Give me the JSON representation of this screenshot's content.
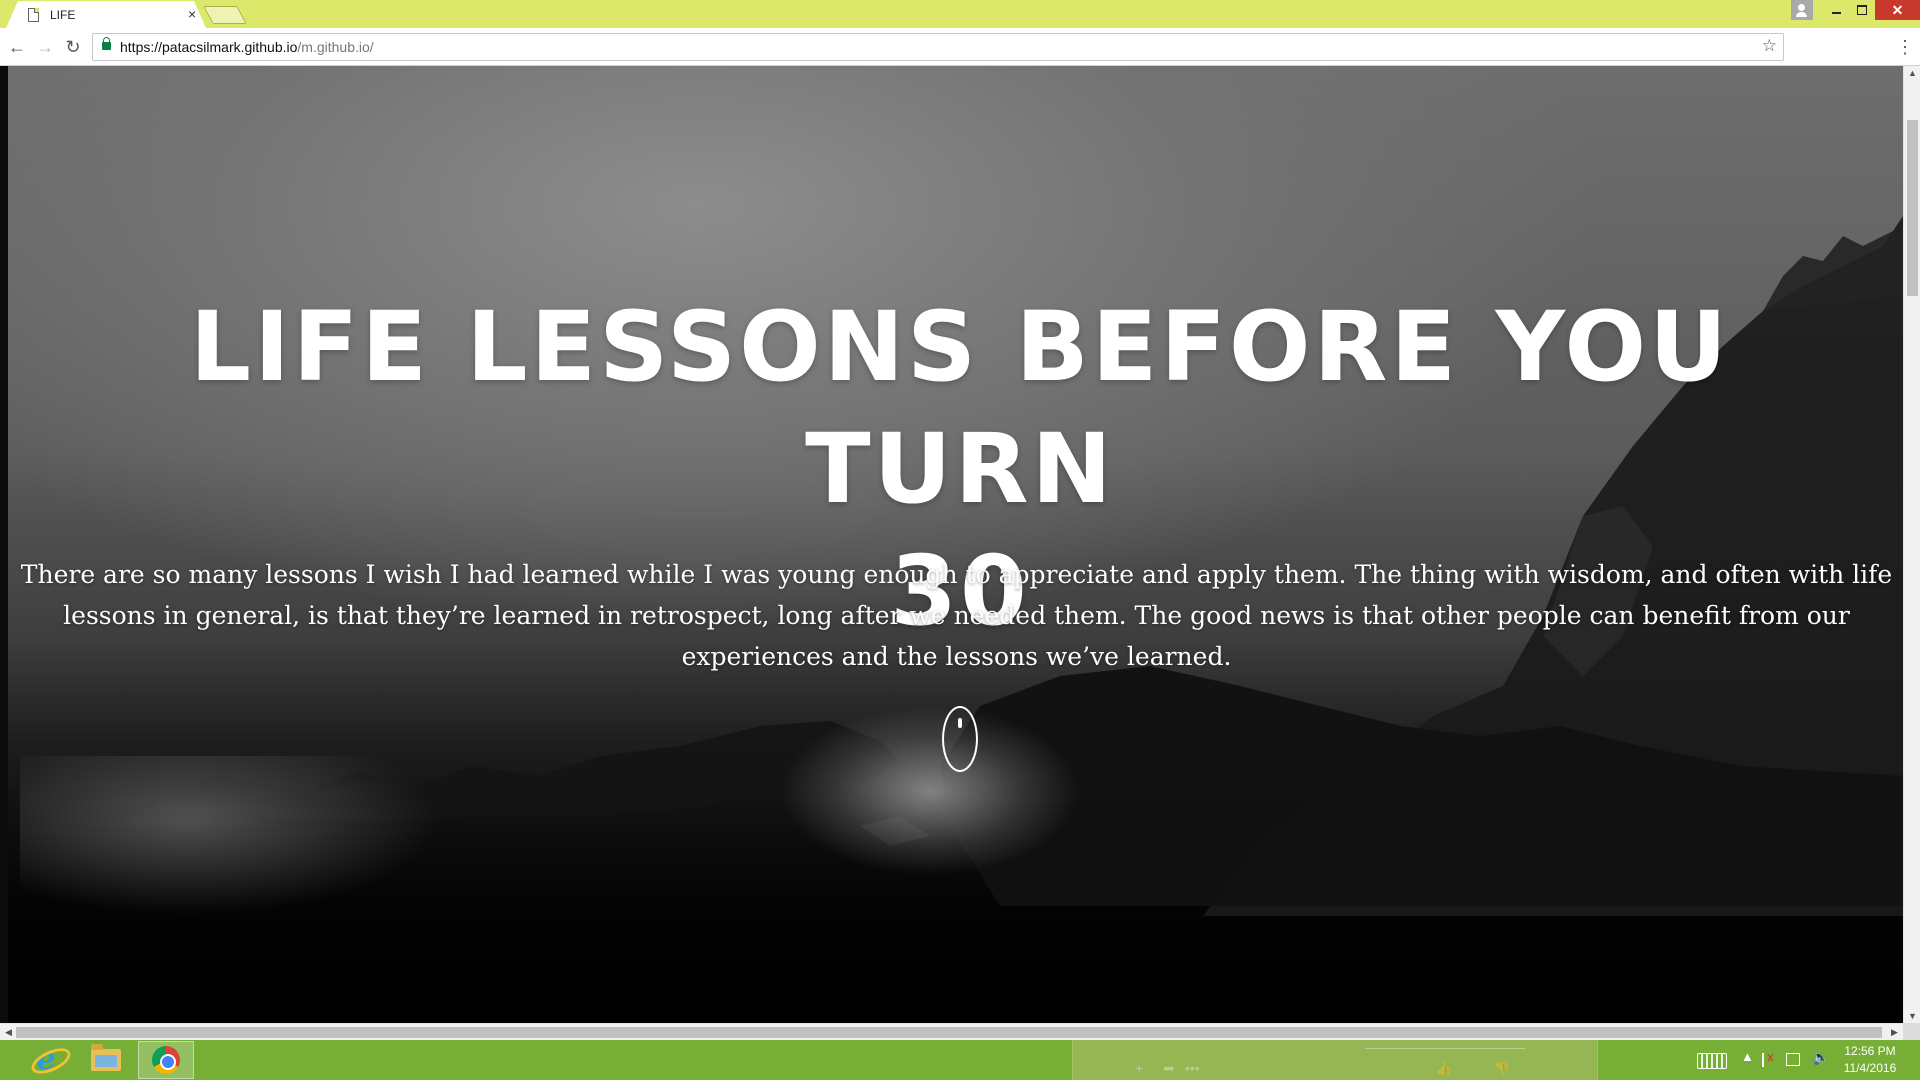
{
  "window": {
    "tab_title": "LIFE",
    "tab_close": "×",
    "minimize": "",
    "maximize": "",
    "close": "✕"
  },
  "toolbar": {
    "back": "←",
    "forward": "→",
    "reload": "↻",
    "url_host": "https://patacsilmark.github.io",
    "url_path": "/m.github.io/",
    "bookmark_star": "☆",
    "menu": "⋮"
  },
  "page": {
    "headline_line1": "LIFE LESSONS BEFORE YOU TURN",
    "headline_line2": "30",
    "intro": "There are so many lessons I wish I had learned while I was young enough to appreciate and apply them. The thing with wisdom, and often with life lessons in general, is that they’re learned in retrospect, long after we needed them. The good news is that other people can benefit from our experiences and the lessons we’ve learned."
  },
  "scrollbars": {
    "up": "▲",
    "down": "▼",
    "left": "◀",
    "right": "▶"
  },
  "taskbar": {
    "apps": [
      {
        "name": "Internet Explorer",
        "icon": "internet-explorer-icon"
      },
      {
        "name": "File Explorer",
        "icon": "folder-icon"
      },
      {
        "name": "Google Chrome",
        "icon": "chrome-icon",
        "active": true
      }
    ],
    "tray_up": "▲",
    "volume": "🔈",
    "time": "12:56 PM",
    "date": "11/4/2016"
  },
  "colors": {
    "titlebar": "#dbe86a",
    "taskbar": "#76ae36",
    "close_button": "#c7392c",
    "lock_green": "#0b8043"
  }
}
